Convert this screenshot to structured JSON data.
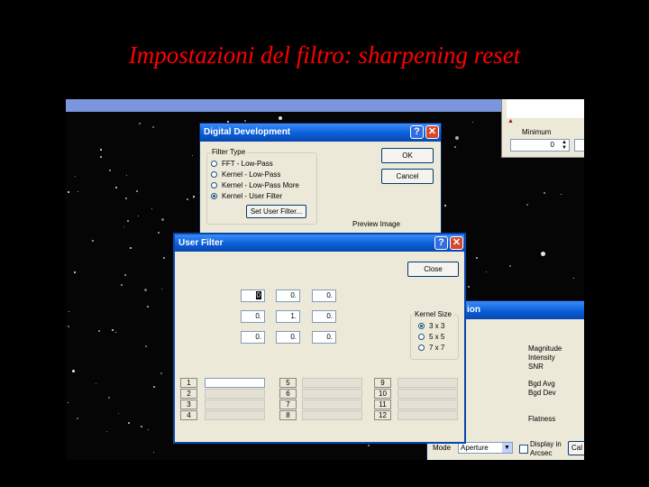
{
  "slide": {
    "title": "Impostazioni del filtro: sharpening reset"
  },
  "colors": {
    "title": "#ff0000",
    "xp_title_bar": "#0a5fd8",
    "window_bg": "#ece9d8"
  },
  "top_panel": {
    "minimum_label": "Minimum",
    "minimum_value": "0",
    "marker": "▲"
  },
  "digital_development": {
    "title": "Digital Development",
    "help_glyph": "?",
    "close_glyph": "✕",
    "filter_type_label": "Filter Type",
    "options": [
      "FFT - Low-Pass",
      "Kernel - Low-Pass",
      "Kernel - Low-Pass More",
      "Kernel - User Filter"
    ],
    "selected_option": 3,
    "set_user_filter_label": "Set User Filter...",
    "ok_label": "OK",
    "cancel_label": "Cancel",
    "preview_label": "Preview Image"
  },
  "user_filter": {
    "title": "User Filter",
    "help_glyph": "?",
    "close_glyph": "✕",
    "close_label": "Close",
    "kernel": [
      [
        "0",
        "0.",
        "0."
      ],
      [
        "0.",
        "1.",
        "0."
      ],
      [
        "0.",
        "0.",
        "0."
      ]
    ],
    "kernel_size_label": "Kernel Size",
    "kernel_sizes": [
      "3 x 3",
      "5 x 5",
      "7 x 7"
    ],
    "selected_kernel_size": 0,
    "slots": [
      "1",
      "2",
      "3",
      "4",
      "5",
      "6",
      "7",
      "8",
      "9",
      "10",
      "11",
      "12"
    ]
  },
  "photometry_panel": {
    "title_fragment": "ion",
    "fields": [
      "Magnitude",
      "Intensity",
      "SNR",
      "Bgd Avg",
      "Bgd Dev",
      "Flatness"
    ],
    "mode_label": "Mode",
    "mode_value": "Aperture",
    "display_in_arcsec_label": "Display in Arcsec",
    "cal_button_fragment": "Cal"
  }
}
